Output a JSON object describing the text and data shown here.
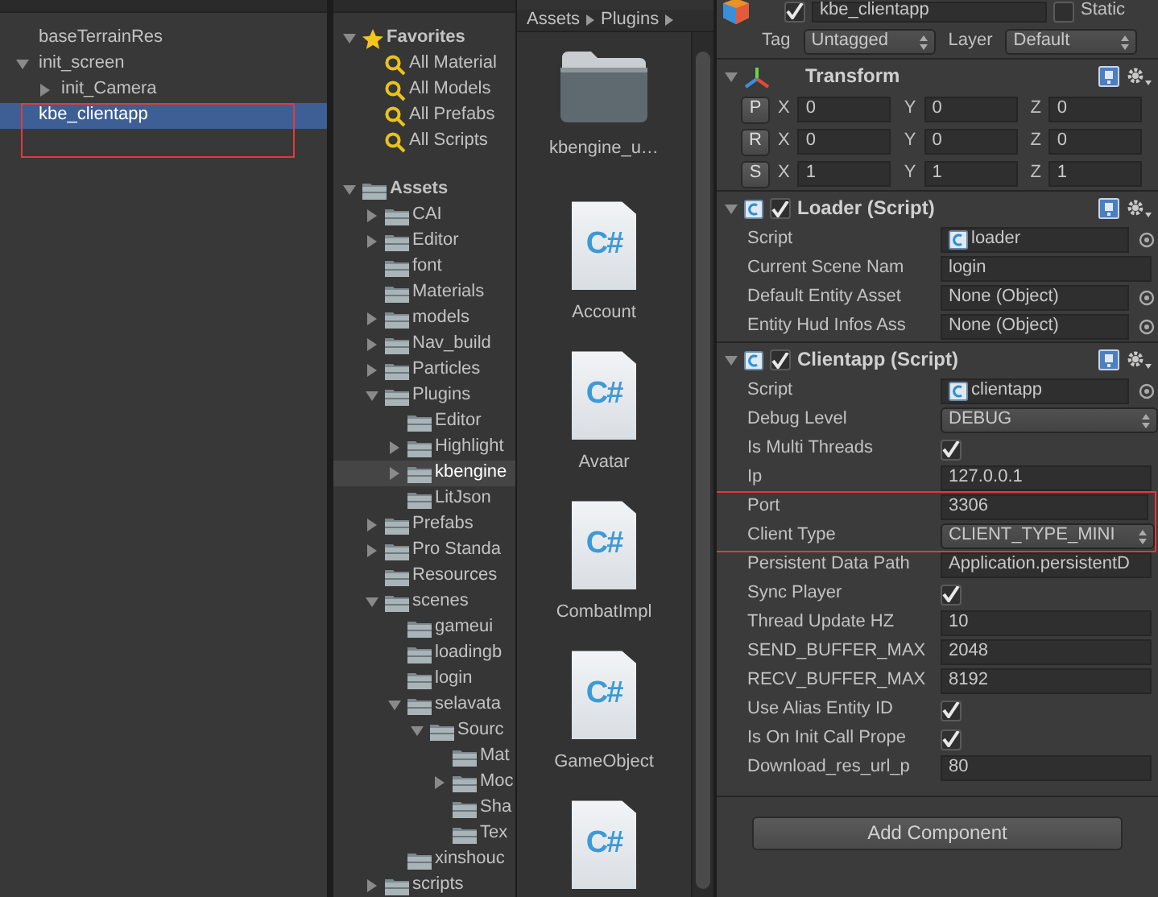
{
  "hierarchy": {
    "items": [
      {
        "label": "baseTerrainRes",
        "selected": false,
        "annotated": false
      },
      {
        "label": "init_screen",
        "selected": false,
        "annotated": false,
        "expanded": true,
        "children": [
          {
            "label": "init_Camera",
            "selected": false,
            "annotated": false,
            "expanded": false
          }
        ]
      },
      {
        "label": "kbe_clientapp",
        "selected": true,
        "annotated": true
      }
    ]
  },
  "project": {
    "favorites": {
      "label": "Favorites",
      "expanded": true,
      "items": [
        {
          "label": "All Material"
        },
        {
          "label": "All Models"
        },
        {
          "label": "All Prefabs"
        },
        {
          "label": "All Scripts"
        }
      ]
    },
    "assets": {
      "label": "Assets",
      "expanded": true,
      "children": [
        {
          "label": "CAI",
          "selected": false,
          "expanded": false
        },
        {
          "label": "Editor",
          "selected": false,
          "expanded": false
        },
        {
          "label": "font",
          "selected": false
        },
        {
          "label": "Materials",
          "selected": false
        },
        {
          "label": "models",
          "selected": false,
          "expanded": false
        },
        {
          "label": "Nav_build",
          "selected": false,
          "expanded": false
        },
        {
          "label": "Particles",
          "selected": false,
          "expanded": false
        },
        {
          "label": "Plugins",
          "selected": false,
          "expanded": true,
          "children": [
            {
              "label": "Editor",
              "selected": false
            },
            {
              "label": "Highlight",
              "selected": false,
              "expanded": false
            },
            {
              "label": "kbengine",
              "selected": true,
              "expanded": false
            },
            {
              "label": "LitJson",
              "selected": false
            }
          ]
        },
        {
          "label": "Prefabs",
          "selected": false,
          "expanded": false
        },
        {
          "label": "Pro Standa",
          "selected": false,
          "expanded": false
        },
        {
          "label": "Resources",
          "selected": false
        },
        {
          "label": "scenes",
          "selected": false,
          "expanded": true,
          "children": [
            {
              "label": "gameui",
              "selected": false
            },
            {
              "label": "loadingb",
              "selected": false
            },
            {
              "label": "login",
              "selected": false
            },
            {
              "label": "selavata",
              "selected": false,
              "expanded": true,
              "children": [
                {
                  "label": "Sourc",
                  "selected": false,
                  "expanded": true,
                  "children": [
                    {
                      "label": "Mat",
                      "selected": false
                    },
                    {
                      "label": "Moc",
                      "selected": false,
                      "expanded": false
                    },
                    {
                      "label": "Sha",
                      "selected": false
                    },
                    {
                      "label": "Tex",
                      "selected": false
                    }
                  ]
                }
              ]
            },
            {
              "label": "xinshouc",
              "selected": false
            }
          ]
        },
        {
          "label": "scripts",
          "selected": false,
          "expanded": false
        }
      ]
    },
    "breadcrumb": [
      "Assets",
      "Plugins"
    ],
    "grid": [
      {
        "kind": "folder",
        "label": "kbengine_u…"
      },
      {
        "kind": "script",
        "icon_text": "C#",
        "label": "Account"
      },
      {
        "kind": "script",
        "icon_text": "C#",
        "label": "Avatar"
      },
      {
        "kind": "script",
        "icon_text": "C#",
        "label": "CombatImpl"
      },
      {
        "kind": "script",
        "icon_text": "C#",
        "label": "GameObject"
      },
      {
        "kind": "script",
        "icon_text": "C#"
      }
    ]
  },
  "inspector": {
    "object": {
      "active": true,
      "name": "kbe_clientapp",
      "static": false,
      "static_label": "Static",
      "tag_label": "Tag",
      "tag": "Untagged",
      "layer_label": "Layer",
      "layer": "Default"
    },
    "components": [
      {
        "kind": "transform",
        "title": "Transform",
        "expanded": true,
        "rows": [
          {
            "button": "P",
            "values": [
              {
                "axis": "X",
                "value": "0"
              },
              {
                "axis": "Y",
                "value": "0"
              },
              {
                "axis": "Z",
                "value": "0"
              }
            ]
          },
          {
            "button": "R",
            "values": [
              {
                "axis": "X",
                "value": "0"
              },
              {
                "axis": "Y",
                "value": "0"
              },
              {
                "axis": "Z",
                "value": "0"
              }
            ]
          },
          {
            "button": "S",
            "values": [
              {
                "axis": "X",
                "value": "1"
              },
              {
                "axis": "Y",
                "value": "1"
              },
              {
                "axis": "Z",
                "value": "1"
              }
            ]
          }
        ]
      },
      {
        "kind": "script",
        "title": "Loader (Script)",
        "enabled": true,
        "expanded": true,
        "fields": [
          {
            "kind": "script_ref",
            "label": "Script",
            "value": "loader",
            "annotated": false
          },
          {
            "kind": "text",
            "label": "Current Scene Nam",
            "value": "login",
            "annotated": false
          },
          {
            "kind": "object",
            "label": "Default Entity Asset",
            "value": "None (Object)",
            "annotated": false
          },
          {
            "kind": "object",
            "label": "Entity Hud Infos Ass",
            "value": "None (Object)",
            "annotated": false
          }
        ]
      },
      {
        "kind": "script",
        "title": "Clientapp (Script)",
        "enabled": true,
        "expanded": true,
        "fields": [
          {
            "kind": "script_ref",
            "label": "Script",
            "value": "clientapp",
            "annotated": false
          },
          {
            "kind": "dropdown",
            "label": "Debug Level",
            "value": "DEBUG",
            "annotated": false
          },
          {
            "kind": "checkbox",
            "label": "Is Multi Threads",
            "checked": true,
            "annotated": false
          },
          {
            "kind": "text",
            "label": "Ip",
            "value": "127.0.0.1",
            "annotated": false
          },
          {
            "kind": "text",
            "label": "Port",
            "value": "3306",
            "annotated": true
          },
          {
            "kind": "dropdown",
            "label": "Client Type",
            "value": "CLIENT_TYPE_MINI",
            "annotated": true
          },
          {
            "kind": "text",
            "label": "Persistent Data Path",
            "value": "Application.persistentD",
            "annotated": false
          },
          {
            "kind": "checkbox",
            "label": "Sync Player",
            "checked": true,
            "annotated": false
          },
          {
            "kind": "text",
            "label": "Thread Update HZ",
            "value": "10",
            "annotated": false
          },
          {
            "kind": "text",
            "label": "SEND_BUFFER_MAX",
            "value": "2048",
            "annotated": false
          },
          {
            "kind": "text",
            "label": "RECV_BUFFER_MAX",
            "value": "8192",
            "annotated": false
          },
          {
            "kind": "checkbox",
            "label": "Use Alias Entity ID",
            "checked": true,
            "annotated": false
          },
          {
            "kind": "checkbox",
            "label": "Is On Init Call Prope",
            "checked": true,
            "annotated": false
          },
          {
            "kind": "text",
            "label": "Download_res_url_p",
            "value": "80",
            "annotated": false
          }
        ]
      }
    ],
    "add_component": "Add Component"
  }
}
